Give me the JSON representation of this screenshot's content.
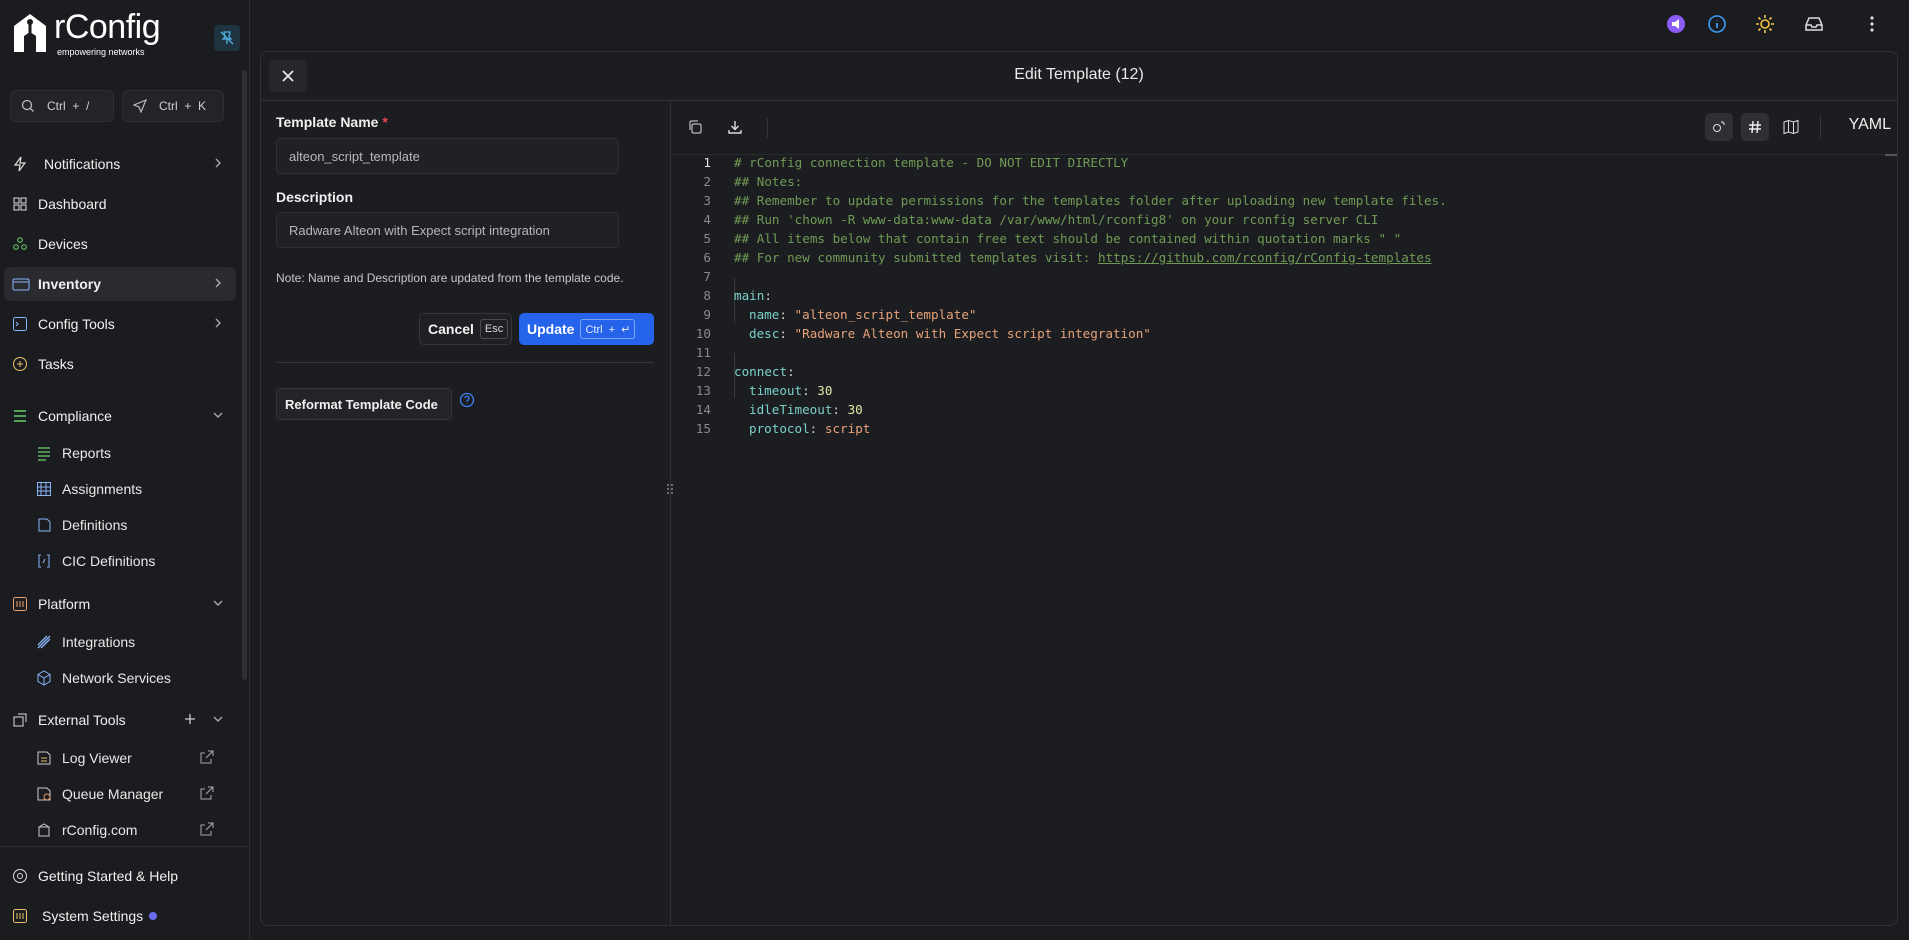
{
  "brand": {
    "name": "rConfig",
    "tagline": "empowering networks"
  },
  "search": {
    "shortcut_search": "Ctrl  +  /",
    "shortcut_command": "Ctrl  +  K"
  },
  "sidebar": {
    "items": [
      {
        "label": "Notifications"
      },
      {
        "label": "Dashboard"
      },
      {
        "label": "Devices"
      },
      {
        "label": "Inventory"
      },
      {
        "label": "Config Tools"
      },
      {
        "label": "Tasks"
      },
      {
        "label": "Compliance"
      },
      {
        "label": "Platform"
      },
      {
        "label": "External Tools"
      }
    ],
    "compliance_sub": [
      "Reports",
      "Assignments",
      "Definitions",
      "CIC Definitions"
    ],
    "platform_sub": [
      "Integrations",
      "Network Services"
    ],
    "external_sub": [
      "Log Viewer",
      "Queue Manager",
      "rConfig.com"
    ],
    "footer": {
      "help": "Getting Started & Help",
      "settings": "System Settings"
    }
  },
  "dialog": {
    "title": "Edit Template (12)",
    "name_label": "Template Name",
    "required_mark": "*",
    "name_value": "alteon_script_template",
    "desc_label": "Description",
    "desc_value": "Radware Alteon with Expect script integration",
    "note": "Note: Name and Description are updated from the template code.",
    "cancel_label": "Cancel",
    "cancel_kbd": "Esc",
    "update_label": "Update",
    "update_kbd": "Ctrl  +  ↵",
    "reformat_label": "Reformat Template Code"
  },
  "editor": {
    "language": "YAML",
    "line_numbers": [
      "1",
      "2",
      "3",
      "4",
      "5",
      "6",
      "7",
      "8",
      "9",
      "10",
      "11",
      "12",
      "13",
      "14",
      "15"
    ],
    "lines": {
      "l1": "# rConfig connection template - DO NOT EDIT DIRECTLY",
      "l2": "## Notes:",
      "l3": "## Remember to update permissions for the templates folder after uploading new template files.",
      "l4": "## Run 'chown -R www-data:www-data /var/www/html/rconfig8' on your rconfig server CLI",
      "l5": "## All items below that contain free text should be contained within quotation marks \" \"",
      "l6_prefix": "## For new community submitted templates visit: ",
      "l6_link": "https://github.com/rconfig/rConfig-templates",
      "main_key": "main",
      "name_key": "name",
      "name_val": "\"alteon_script_template\"",
      "desc_key": "desc",
      "desc_val": "\"Radware Alteon with Expect script integration\"",
      "connect_key": "connect",
      "timeout_key": "timeout",
      "timeout_val": "30",
      "idle_key": "idleTimeout",
      "idle_val": "30",
      "protocol_key": "protocol",
      "protocol_val": "script",
      "colon": ":"
    }
  },
  "colors": {
    "accent": "#2563eb",
    "comment": "#6f9a55",
    "key": "#7ad0c8",
    "string": "#e7a27a",
    "number": "#e6e6a6"
  }
}
